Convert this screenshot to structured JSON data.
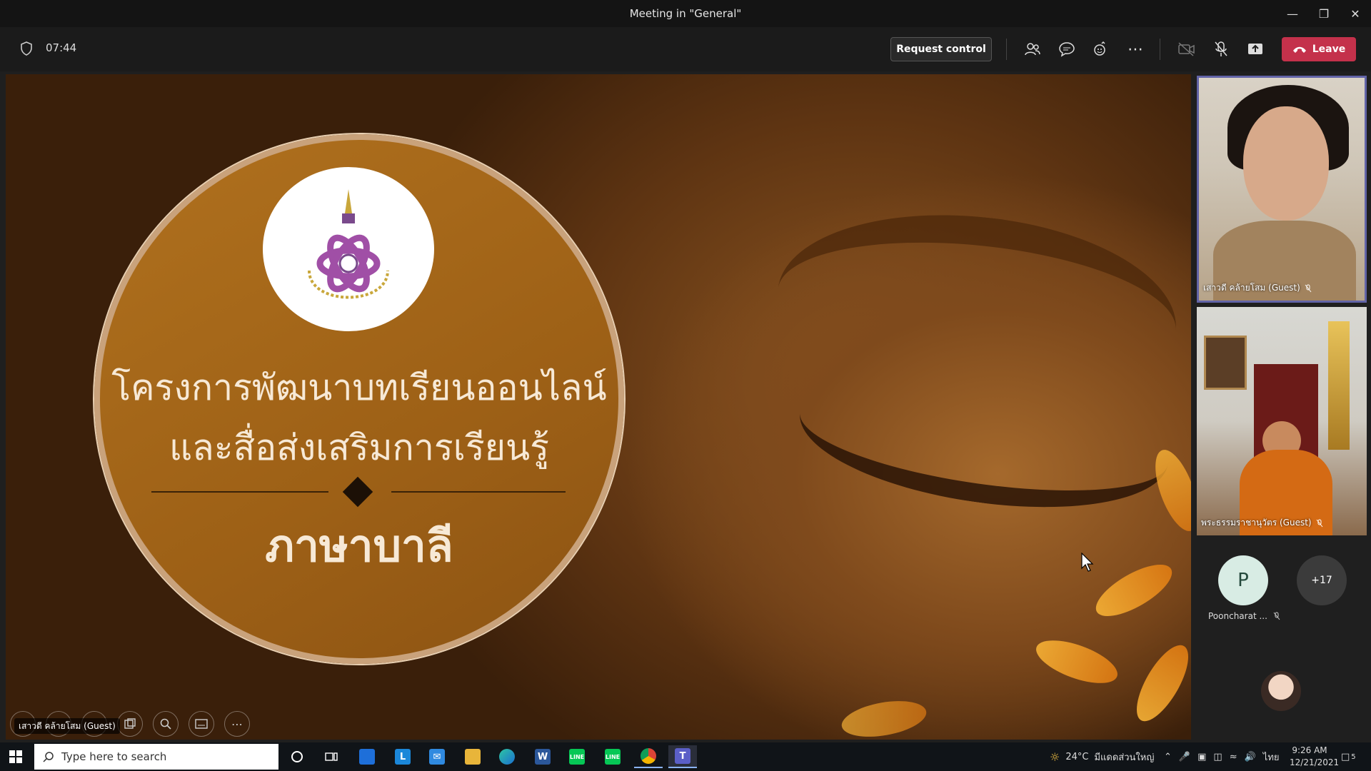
{
  "window": {
    "title": "Meeting in \"General\""
  },
  "toolbar": {
    "timer": "07:44",
    "request_control_label": "Request control",
    "leave_label": "Leave",
    "icons": [
      "participants-icon",
      "chat-icon",
      "reactions-icon",
      "more-options-icon",
      "camera-off-icon",
      "mic-off-icon",
      "share-screen-icon"
    ]
  },
  "slide": {
    "line1": "โครงการพัฒนาบทเรียนออนไลน์",
    "line2": "และสื่อส่งเสริมการเรียนรู้",
    "line3": "ภาษาบาลี"
  },
  "stage": {
    "presenter_label": "เสาวดี คล้ายโสม (Guest)"
  },
  "participants": {
    "tile1_name": "เสาวดี คล้ายโสม (Guest)",
    "tile2_name": "พระธรรมราชานุวัตร (Guest)",
    "avatar_initial": "P",
    "avatar_name": "Poonchara​t ...",
    "overflow_count": "+17"
  },
  "taskbar": {
    "search_placeholder": "Type here to search",
    "weather_temp": "24°C",
    "weather_desc": "มีแดดส่วนใหญ่",
    "lang": "ไทย",
    "time": "9:26 AM",
    "date": "12/21/2021",
    "notification_count": "5"
  },
  "colors": {
    "leave": "#c4314b",
    "accent": "#6264a7",
    "toolbar_bg": "#1b1b1b"
  }
}
